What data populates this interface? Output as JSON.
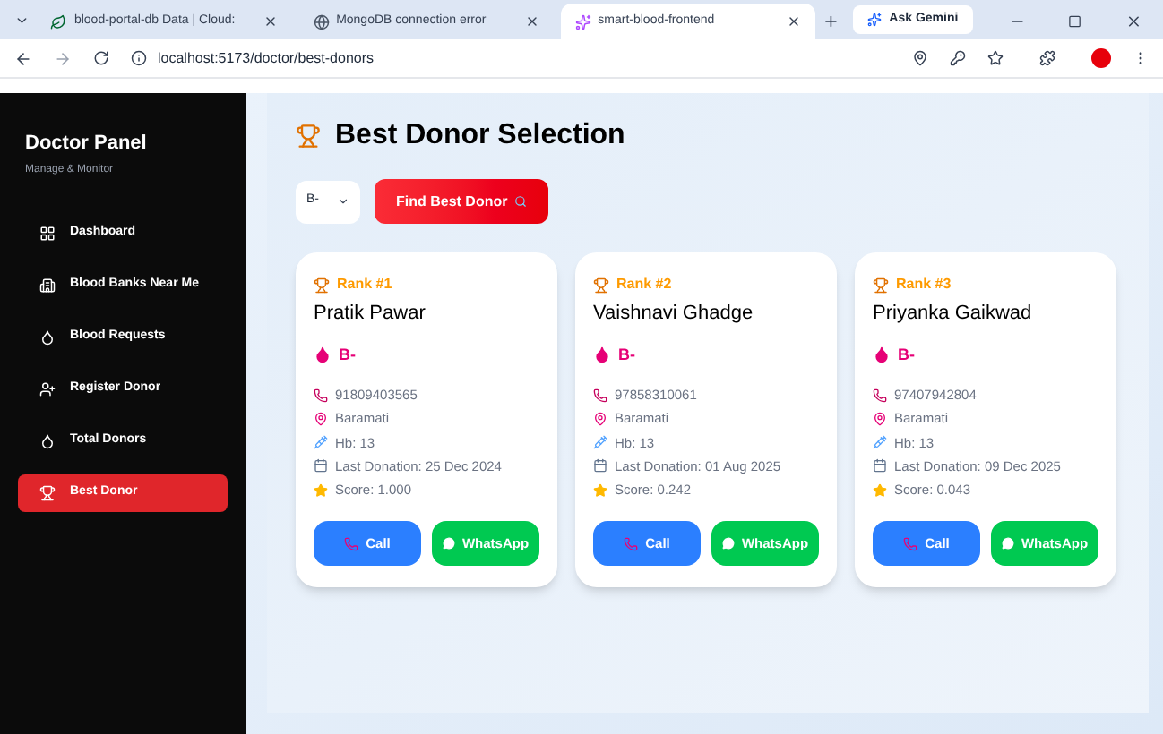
{
  "browser": {
    "tabs": [
      {
        "title": "blood-portal-db Data | Cloud: ",
        "selected": false
      },
      {
        "title": "MongoDB connection error",
        "selected": false
      },
      {
        "title": "smart-blood-frontend",
        "selected": true
      }
    ],
    "ask_button": "Ask Gemini",
    "url": "localhost:5173/doctor/best-donors"
  },
  "sidebar": {
    "title": "Doctor Panel",
    "subtitle": "Manage & Monitor",
    "items": [
      {
        "label": "Dashboard",
        "selected": false
      },
      {
        "label": "Blood Banks Near Me",
        "selected": false
      },
      {
        "label": "Blood Requests",
        "selected": false
      },
      {
        "label": "Register Donor",
        "selected": false
      },
      {
        "label": "Total Donors",
        "selected": false
      },
      {
        "label": "Best Donor",
        "selected": true
      }
    ]
  },
  "page": {
    "title": "Best Donor Selection",
    "blood_group_select": "B-",
    "find_button": "Find Best Donor"
  },
  "donors": [
    {
      "rank": "Rank #1",
      "name": "Pratik Pawar",
      "blood_group": "B-",
      "phone": "91809403565",
      "city": "Baramati",
      "hb": "Hb: 13",
      "last_donation": "Last Donation: 25 Dec 2024",
      "score": "Score: 1.000",
      "call": "Call",
      "whatsapp": "WhatsApp"
    },
    {
      "rank": "Rank #2",
      "name": "Vaishnavi Ghadge",
      "blood_group": "B-",
      "phone": "97858310061",
      "city": "Baramati",
      "hb": "Hb: 13",
      "last_donation": "Last Donation: 01 Aug 2025",
      "score": "Score: 0.242",
      "call": "Call",
      "whatsapp": "WhatsApp"
    },
    {
      "rank": "Rank #3",
      "name": "Priyanka Gaikwad",
      "blood_group": "B-",
      "phone": "97407942804",
      "city": "Baramati",
      "hb": "Hb: 13",
      "last_donation": "Last Donation: 09 Dec 2025",
      "score": "Score: 0.043",
      "call": "Call",
      "whatsapp": "WhatsApp"
    }
  ]
}
